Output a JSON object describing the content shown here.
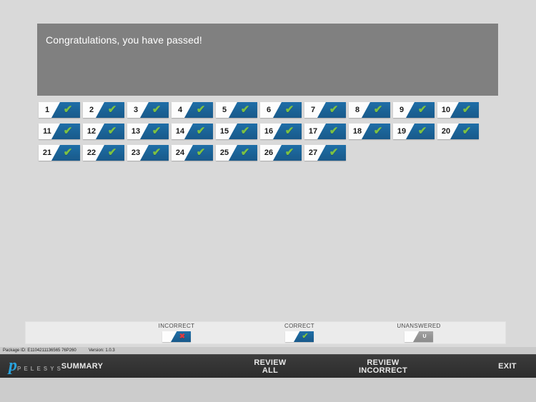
{
  "banner": {
    "message": "Congratulations, you have passed!",
    "background_color": "#808080",
    "text_color": "#ffffff"
  },
  "colors": {
    "page_background": "#d9d9d9",
    "tile_blue": "#1b6397",
    "tile_gray": "#949494",
    "correct_green": "#7dc143",
    "incorrect_red": "#e03a3e",
    "toolbar_dark": "#343434",
    "brand_blue": "#29a3dd",
    "legend_panel": "#ebebeb"
  },
  "glyphs": {
    "correct": "✔",
    "incorrect": "✖",
    "unanswered": "U"
  },
  "questions": {
    "total": 27,
    "per_row": 10,
    "items": [
      {
        "number": "1",
        "status": "correct"
      },
      {
        "number": "2",
        "status": "correct"
      },
      {
        "number": "3",
        "status": "correct"
      },
      {
        "number": "4",
        "status": "correct"
      },
      {
        "number": "5",
        "status": "correct"
      },
      {
        "number": "6",
        "status": "correct"
      },
      {
        "number": "7",
        "status": "correct"
      },
      {
        "number": "8",
        "status": "correct"
      },
      {
        "number": "9",
        "status": "correct"
      },
      {
        "number": "10",
        "status": "correct"
      },
      {
        "number": "11",
        "status": "correct"
      },
      {
        "number": "12",
        "status": "correct"
      },
      {
        "number": "13",
        "status": "correct"
      },
      {
        "number": "14",
        "status": "correct"
      },
      {
        "number": "15",
        "status": "correct"
      },
      {
        "number": "16",
        "status": "correct"
      },
      {
        "number": "17",
        "status": "correct"
      },
      {
        "number": "18",
        "status": "correct"
      },
      {
        "number": "19",
        "status": "correct"
      },
      {
        "number": "20",
        "status": "correct"
      },
      {
        "number": "21",
        "status": "correct"
      },
      {
        "number": "22",
        "status": "correct"
      },
      {
        "number": "23",
        "status": "correct"
      },
      {
        "number": "24",
        "status": "correct"
      },
      {
        "number": "25",
        "status": "correct"
      },
      {
        "number": "26",
        "status": "correct"
      },
      {
        "number": "27",
        "status": "correct"
      }
    ]
  },
  "legend": {
    "incorrect_label": "INCORRECT",
    "correct_label": "CORRECT",
    "unanswered_label": "UNANSWERED"
  },
  "meta": {
    "package_id": "Package ID: E1104211136565 76P260",
    "version": "Version: 1.0.3"
  },
  "toolbar": {
    "brand_initial": "p",
    "brand_name": "PELESYS",
    "summary_label": "SUMMARY",
    "review_all_line1": "REVIEW",
    "review_all_line2": "ALL",
    "review_incorrect_line1": "REVIEW",
    "review_incorrect_line2": "INCORRECT",
    "exit_label": "EXIT"
  }
}
